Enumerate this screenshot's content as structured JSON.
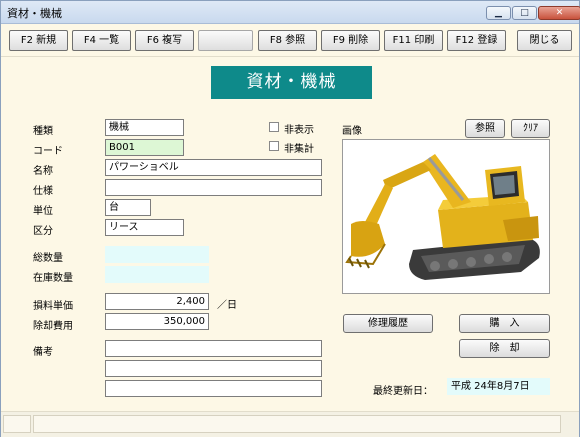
{
  "window": {
    "title": "資材・機械"
  },
  "toolbar": {
    "f2": "F2 新規",
    "f4": "F4 一覧",
    "f6": "F6 複写",
    "blank": "",
    "f8": "F8 参照",
    "f9": "F9 削除",
    "f11": "F11 印刷",
    "f12": "F12 登録",
    "close": "閉じる"
  },
  "header": {
    "title": "資材・機械"
  },
  "form": {
    "type_label": "種類",
    "type_value": "機械",
    "code_label": "コード",
    "code_value": "B001",
    "name_label": "名称",
    "name_value": "パワーショベル",
    "spec_label": "仕様",
    "spec_value": "",
    "unit_label": "単位",
    "unit_value": "台",
    "category_label": "区分",
    "category_value": "リース",
    "total_qty_label": "総数量",
    "total_qty_value": "",
    "stock_qty_label": "在庫数量",
    "stock_qty_value": "",
    "rental_price_label": "損料単価",
    "rental_price_value": "2,400",
    "rental_unit": "／日",
    "disposal_cost_label": "除却費用",
    "disposal_cost_value": "350,000",
    "notes_label": "備考",
    "notes": [
      "",
      "",
      ""
    ],
    "hidden_label": "非表示",
    "hidden_checked": false,
    "no_total_label": "非集計",
    "no_total_checked": false
  },
  "image": {
    "label": "画像",
    "browse": "参照",
    "clear": "ｸﾘｱ"
  },
  "actions": {
    "repair_history": "修理履歴",
    "purchase": "購　入",
    "dispose": "除　却"
  },
  "footer": {
    "updated_label": "最終更新日：",
    "updated_value": "平成 24年8月7日"
  },
  "colors": {
    "banner": "#0e8a8a",
    "background": "#fdf8e6"
  }
}
